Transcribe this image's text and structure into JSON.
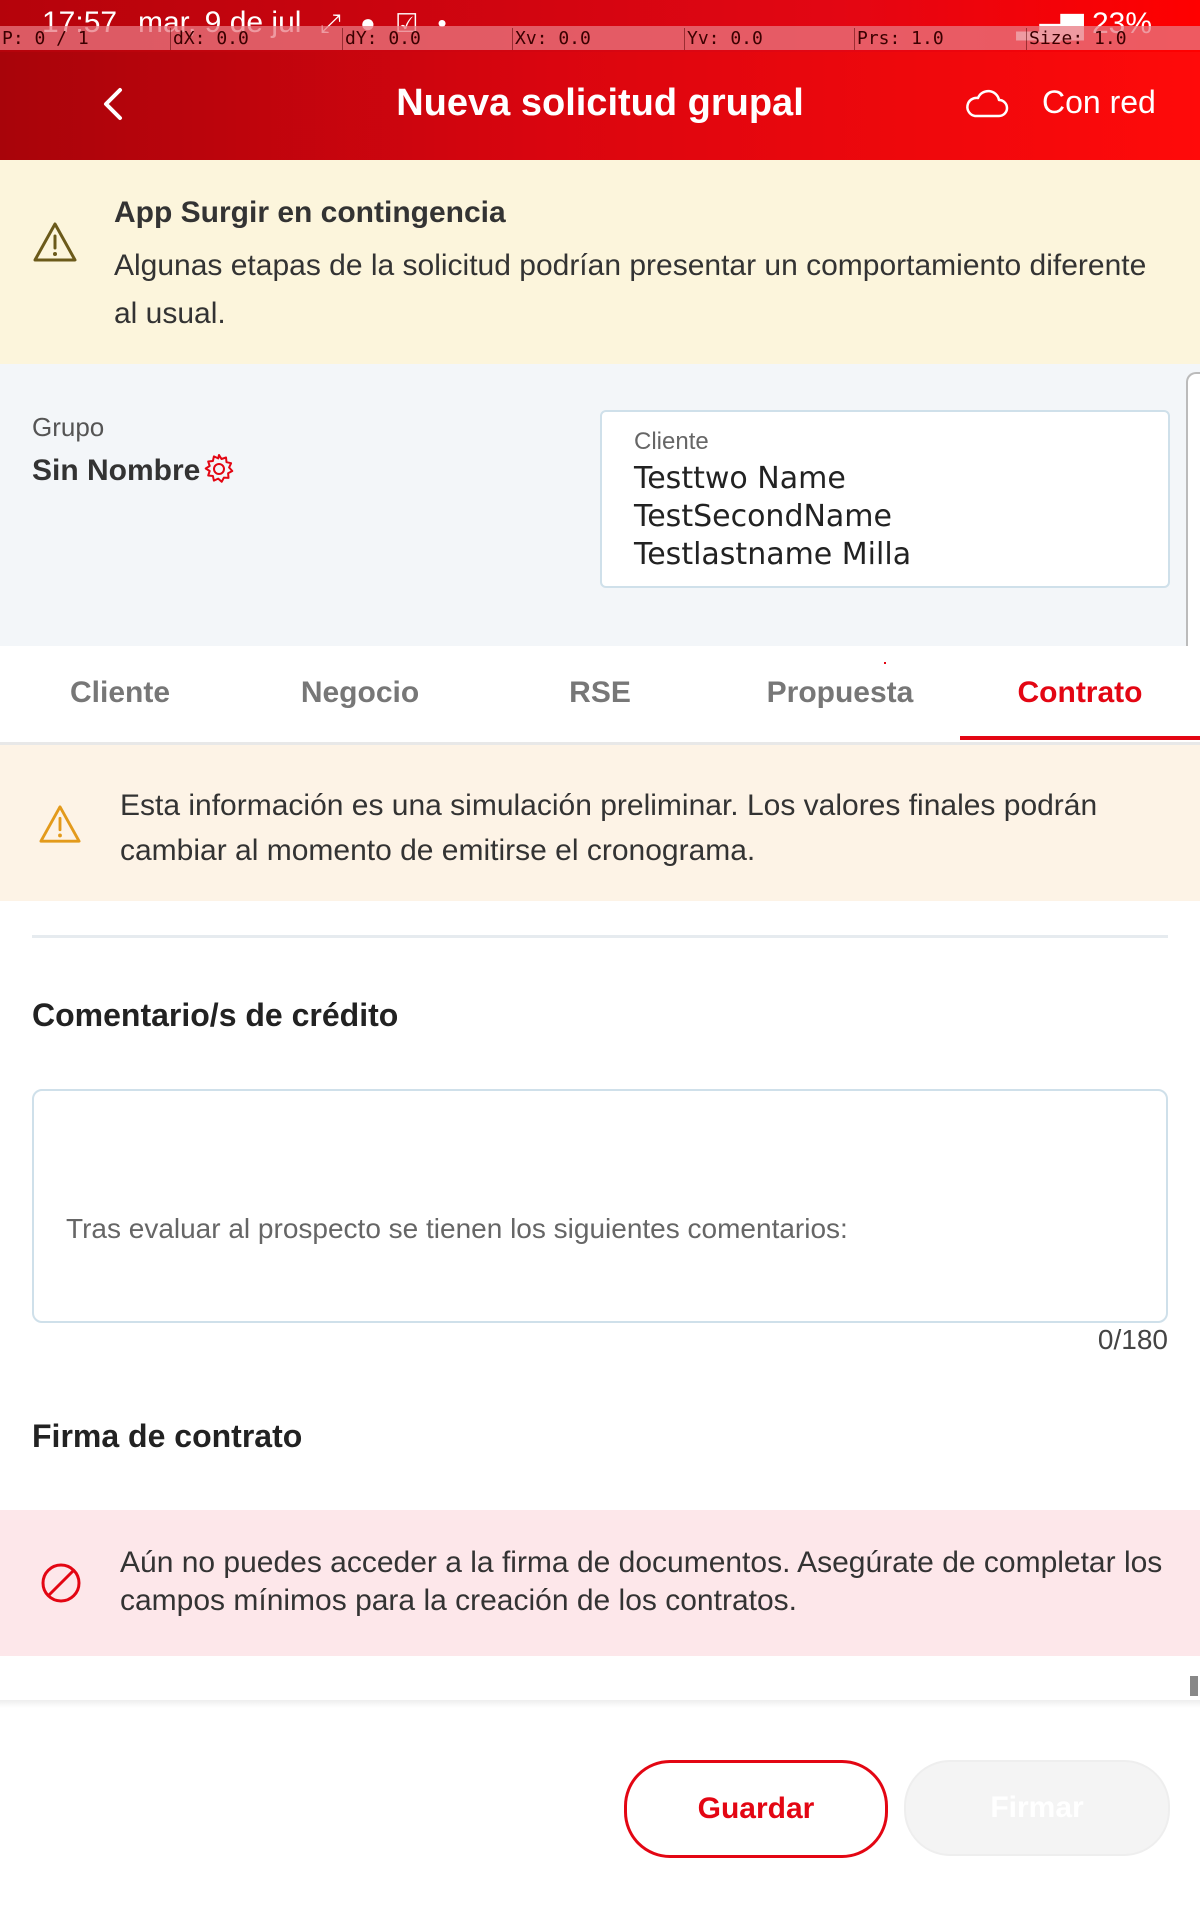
{
  "status_bar": {
    "time": "17:57",
    "date": "mar, 9 de jul",
    "battery": "23%"
  },
  "debug_overlay": {
    "p": "P: 0 / 1",
    "dx": "dX: 0.0",
    "dy": "dY: 0.0",
    "xv": "Xv: 0.0",
    "yv": "Yv: 0.0",
    "prs": "Prs: 1.0",
    "size": "Size: 1.0"
  },
  "header": {
    "title": "Nueva solicitud grupal",
    "connection_label": "Con red"
  },
  "contingency_banner": {
    "title": "App Surgir en contingencia",
    "text": "Algunas etapas de la solicitud podrían presentar un comportamiento diferente al usual."
  },
  "group": {
    "label": "Grupo",
    "name": "Sin Nombre"
  },
  "client": {
    "label": "Cliente",
    "value": "Testtwo Name\nTestSecondName\nTestlastname Milla"
  },
  "tabs": [
    {
      "label": "Cliente"
    },
    {
      "label": "Negocio"
    },
    {
      "label": "RSE"
    },
    {
      "label": "Propuesta"
    },
    {
      "label": "Contrato",
      "active": true
    }
  ],
  "simulation_note": {
    "text": "Esta información es una simulación preliminar. Los valores finales podrán cambiar al momento de emitirse el cronograma."
  },
  "credit_comments": {
    "title": "Comentario/s de crédito",
    "placeholder": "Tras evaluar al prospecto se tienen los siguientes comentarios:",
    "counter": "0/180"
  },
  "contract_signature": {
    "title": "Firma de contrato",
    "error": "Aún no puedes acceder a la firma de documentos. Asegúrate de completar los campos mínimos para la creación de los contratos."
  },
  "actions": {
    "save_label": "Guardar",
    "sign_label": "Firmar"
  },
  "colors": {
    "brand_red": "#e30613",
    "warning_bg": "#fcf5dc",
    "error_bg": "#fde7ea"
  },
  "icons": {
    "back": "chevron-left-icon",
    "cloud": "cloud-icon",
    "warning": "warning-triangle-icon",
    "settings": "gear-icon",
    "blocked": "block-icon"
  }
}
